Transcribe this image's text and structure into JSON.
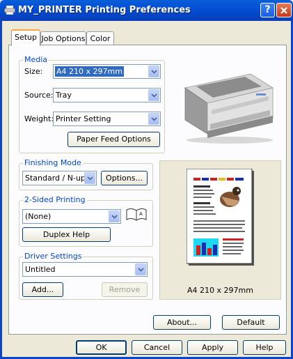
{
  "window": {
    "title": "MY_PRINTER Printing Preferences"
  },
  "tabs": [
    {
      "label": "Setup"
    },
    {
      "label": "Job Options"
    },
    {
      "label": "Color"
    }
  ],
  "media": {
    "group_label": "Media",
    "size_label": "Size:",
    "size_value": "A4 210 x 297mm",
    "source_label": "Source:",
    "source_value": "Tray",
    "weight_label": "Weight:",
    "weight_value": "Printer Setting",
    "paper_feed_button": "Paper Feed Options"
  },
  "finishing": {
    "group_label": "Finishing Mode",
    "value": "Standard / N-up",
    "options_button": "Options..."
  },
  "two_sided": {
    "group_label": "2-Sided Printing",
    "value": "(None)",
    "duplex_help_button": "Duplex Help"
  },
  "driver": {
    "group_label": "Driver Settings",
    "value": "Untitled",
    "add_button": "Add...",
    "remove_button": "Remove"
  },
  "preview": {
    "paper_caption": "A4 210 x 297mm"
  },
  "footer": {
    "about_button": "About...",
    "default_button": "Default",
    "ok_button": "OK",
    "cancel_button": "Cancel",
    "apply_button": "Apply",
    "help_button": "Help"
  },
  "colors": {
    "title_bar": "#0450d6",
    "group_label": "#0046d5",
    "selection": "#316ac5",
    "close": "#c7381a"
  }
}
